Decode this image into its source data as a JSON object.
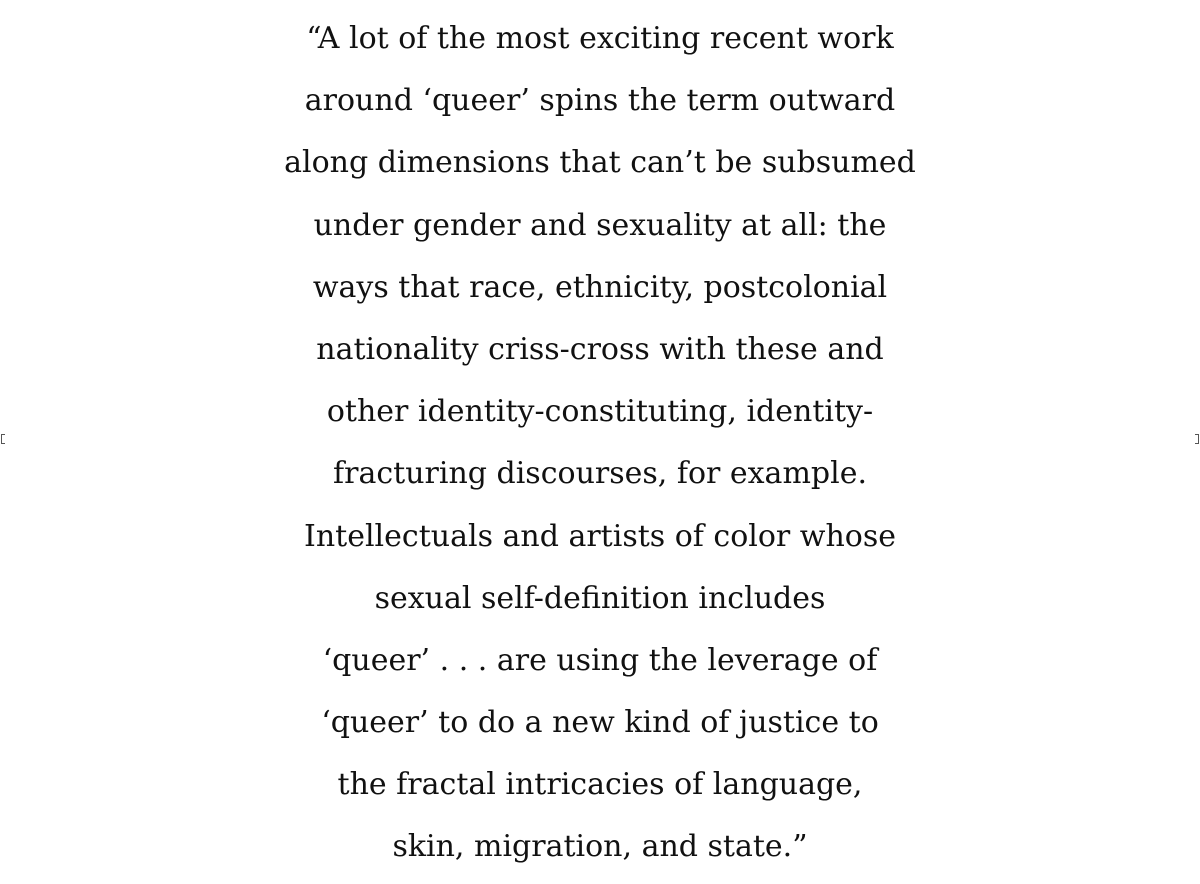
{
  "quote": {
    "lines": [
      "“A lot of the most exciting recent work",
      "around ‘queer’ spins the term outward",
      "along dimensions that can’t be subsumed",
      "under gender and sexuality at all: the",
      "ways that race, ethnicity, postcolonial",
      "nationality criss-cross with these and",
      "other identity-constituting, identity-",
      "fracturing discourses, for example.",
      "Intellectuals and artists of color whose",
      "sexual self-definition includes",
      "‘queer’ . . . are using the leverage of",
      "‘queer’ to do a new kind of justice to",
      "the fractal intricacies of language,",
      "skin, migration, and state.”"
    ]
  }
}
